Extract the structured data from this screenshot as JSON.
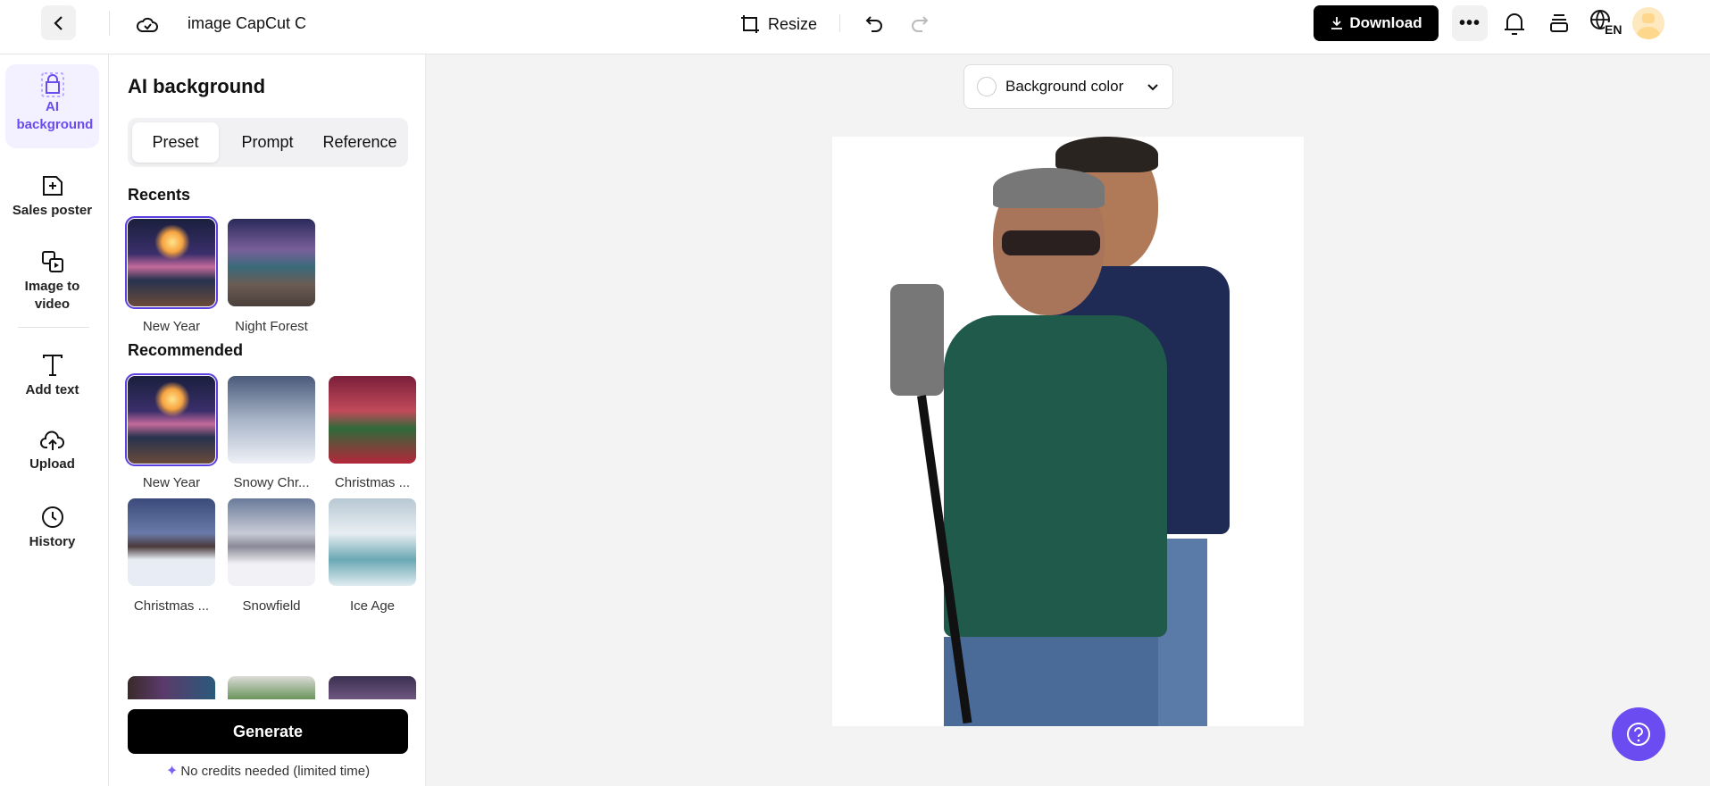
{
  "header": {
    "title": "image CapCut C",
    "resize_label": "Resize",
    "download_label": "Download",
    "language": "EN"
  },
  "rail": {
    "items": [
      {
        "label": "AI background"
      },
      {
        "label": "Sales poster"
      },
      {
        "label": "Image to video"
      },
      {
        "label": "Add text"
      },
      {
        "label": "Upload"
      },
      {
        "label": "History"
      }
    ]
  },
  "panel": {
    "title": "AI background",
    "tabs": [
      "Preset",
      "Prompt",
      "Reference"
    ],
    "recents_label": "Recents",
    "recents": [
      {
        "label": "New Year"
      },
      {
        "label": "Night Forest"
      }
    ],
    "recommended_label": "Recommended",
    "recommended": [
      {
        "label": "New Year"
      },
      {
        "label": "Snowy Chr..."
      },
      {
        "label": "Christmas ..."
      },
      {
        "label": "Christmas ..."
      },
      {
        "label": "Snowfield"
      },
      {
        "label": "Ice Age"
      },
      {
        "label": ""
      },
      {
        "label": ""
      },
      {
        "label": ""
      }
    ],
    "generate_label": "Generate",
    "credits_note": "No credits needed (limited time)"
  },
  "canvas": {
    "background_color_label": "Background color"
  },
  "colors": {
    "accent": "#6a4cf0",
    "help": "#6a4cf0"
  }
}
